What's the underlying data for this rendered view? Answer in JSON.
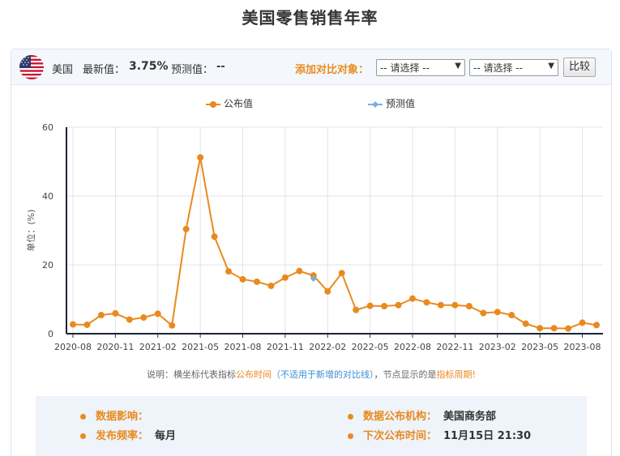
{
  "page": {
    "title": "美国零售销售年率"
  },
  "header": {
    "country": "美国",
    "latest_label": "最新值：",
    "latest_value": "3.75%",
    "forecast_label": "预测值：",
    "forecast_value": "--",
    "add_compare_label": "添加对比对象：",
    "select_1": "-- 请选择 --",
    "select_2": "-- 请选择 --",
    "compare_button": "比较"
  },
  "legend": {
    "published": "公布值",
    "forecast": "预测值"
  },
  "note": {
    "prefix": "说明：横坐标代表指标",
    "highlight_1": "公布时间",
    "paren": "（不适用于新增的对比线）",
    "middle": "，节点显示的是",
    "highlight_2": "指标周期!"
  },
  "info": {
    "impact_label": "数据影响：",
    "impact_value": "",
    "agency_label": "数据公布机构：",
    "agency_value": "美国商务部",
    "frequency_label": "发布频率：",
    "frequency_value": "每月",
    "next_label": "下次公布时间：",
    "next_value": "11月15日 21:30"
  },
  "colors": {
    "published": "#e88a1e",
    "forecast": "#7aaee0",
    "accent": "#e88a1e"
  },
  "icons": {
    "flag": "us-flag-icon"
  },
  "chart_data": {
    "type": "line",
    "ylabel": "单位：(%)",
    "ylim": [
      0,
      60
    ],
    "yticks": [
      0,
      20,
      40,
      60
    ],
    "x_ticks": [
      "2020-08",
      "2020-11",
      "2021-02",
      "2021-05",
      "2021-08",
      "2021-11",
      "2022-02",
      "2022-05",
      "2022-08",
      "2022-11",
      "2023-02",
      "2023-05",
      "2023-08"
    ],
    "grid": true,
    "legend_position": "top",
    "series": [
      {
        "name": "公布值",
        "color": "#e88a1e",
        "values": [
          2.7,
          2.6,
          5.4,
          5.9,
          4.1,
          4.7,
          5.8,
          2.4,
          30.4,
          51.2,
          28.2,
          18.1,
          15.8,
          15.1,
          13.9,
          16.3,
          18.2,
          16.9,
          12.3,
          17.6,
          6.9,
          8.1,
          8.0,
          8.3,
          10.2,
          9.1,
          8.3,
          8.3,
          8.0,
          6.0,
          6.3,
          5.4,
          2.9,
          1.6,
          1.6,
          1.5,
          3.2,
          2.5
        ]
      },
      {
        "name": "预测值",
        "color": "#7aaee0",
        "values": [
          null,
          null,
          null,
          null,
          null,
          null,
          null,
          null,
          null,
          null,
          null,
          null,
          null,
          null,
          null,
          null,
          null,
          16.0,
          null,
          null,
          null,
          null,
          null,
          null,
          null,
          null,
          null,
          null,
          null,
          null,
          null,
          null,
          null,
          null,
          null,
          null,
          null,
          null
        ]
      }
    ]
  }
}
